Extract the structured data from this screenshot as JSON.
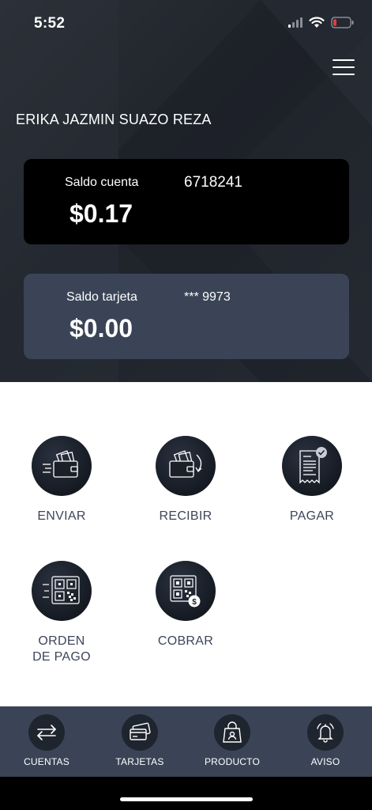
{
  "status": {
    "time": "5:52"
  },
  "user": {
    "name": "ERIKA JAZMIN SUAZO REZA"
  },
  "account": {
    "label": "Saldo cuenta",
    "number": "6718241",
    "balance": "$0.17"
  },
  "card": {
    "label": "Saldo tarjeta",
    "number": "*** 9973",
    "balance": "$0.00"
  },
  "actions": [
    {
      "label": "ENVIAR",
      "icon": "wallet-send-icon"
    },
    {
      "label": "RECIBIR",
      "icon": "wallet-receive-icon"
    },
    {
      "label": "PAGAR",
      "icon": "receipt-check-icon"
    },
    {
      "label": "ORDEN\nDE PAGO",
      "icon": "qr-send-icon"
    },
    {
      "label": "COBRAR",
      "icon": "qr-dollar-icon"
    }
  ],
  "nav": [
    {
      "label": "CUENTAS",
      "icon": "transfer-arrows-icon"
    },
    {
      "label": "TARJETAS",
      "icon": "cards-icon"
    },
    {
      "label": "PRODUCTO",
      "icon": "shopping-bag-icon"
    },
    {
      "label": "AVISO",
      "icon": "bell-icon"
    }
  ],
  "colors": {
    "header": "#252931",
    "card_secondary": "#3a4456",
    "nav": "#3a4456",
    "action_text": "#3d4557",
    "battery": "#e53935"
  }
}
